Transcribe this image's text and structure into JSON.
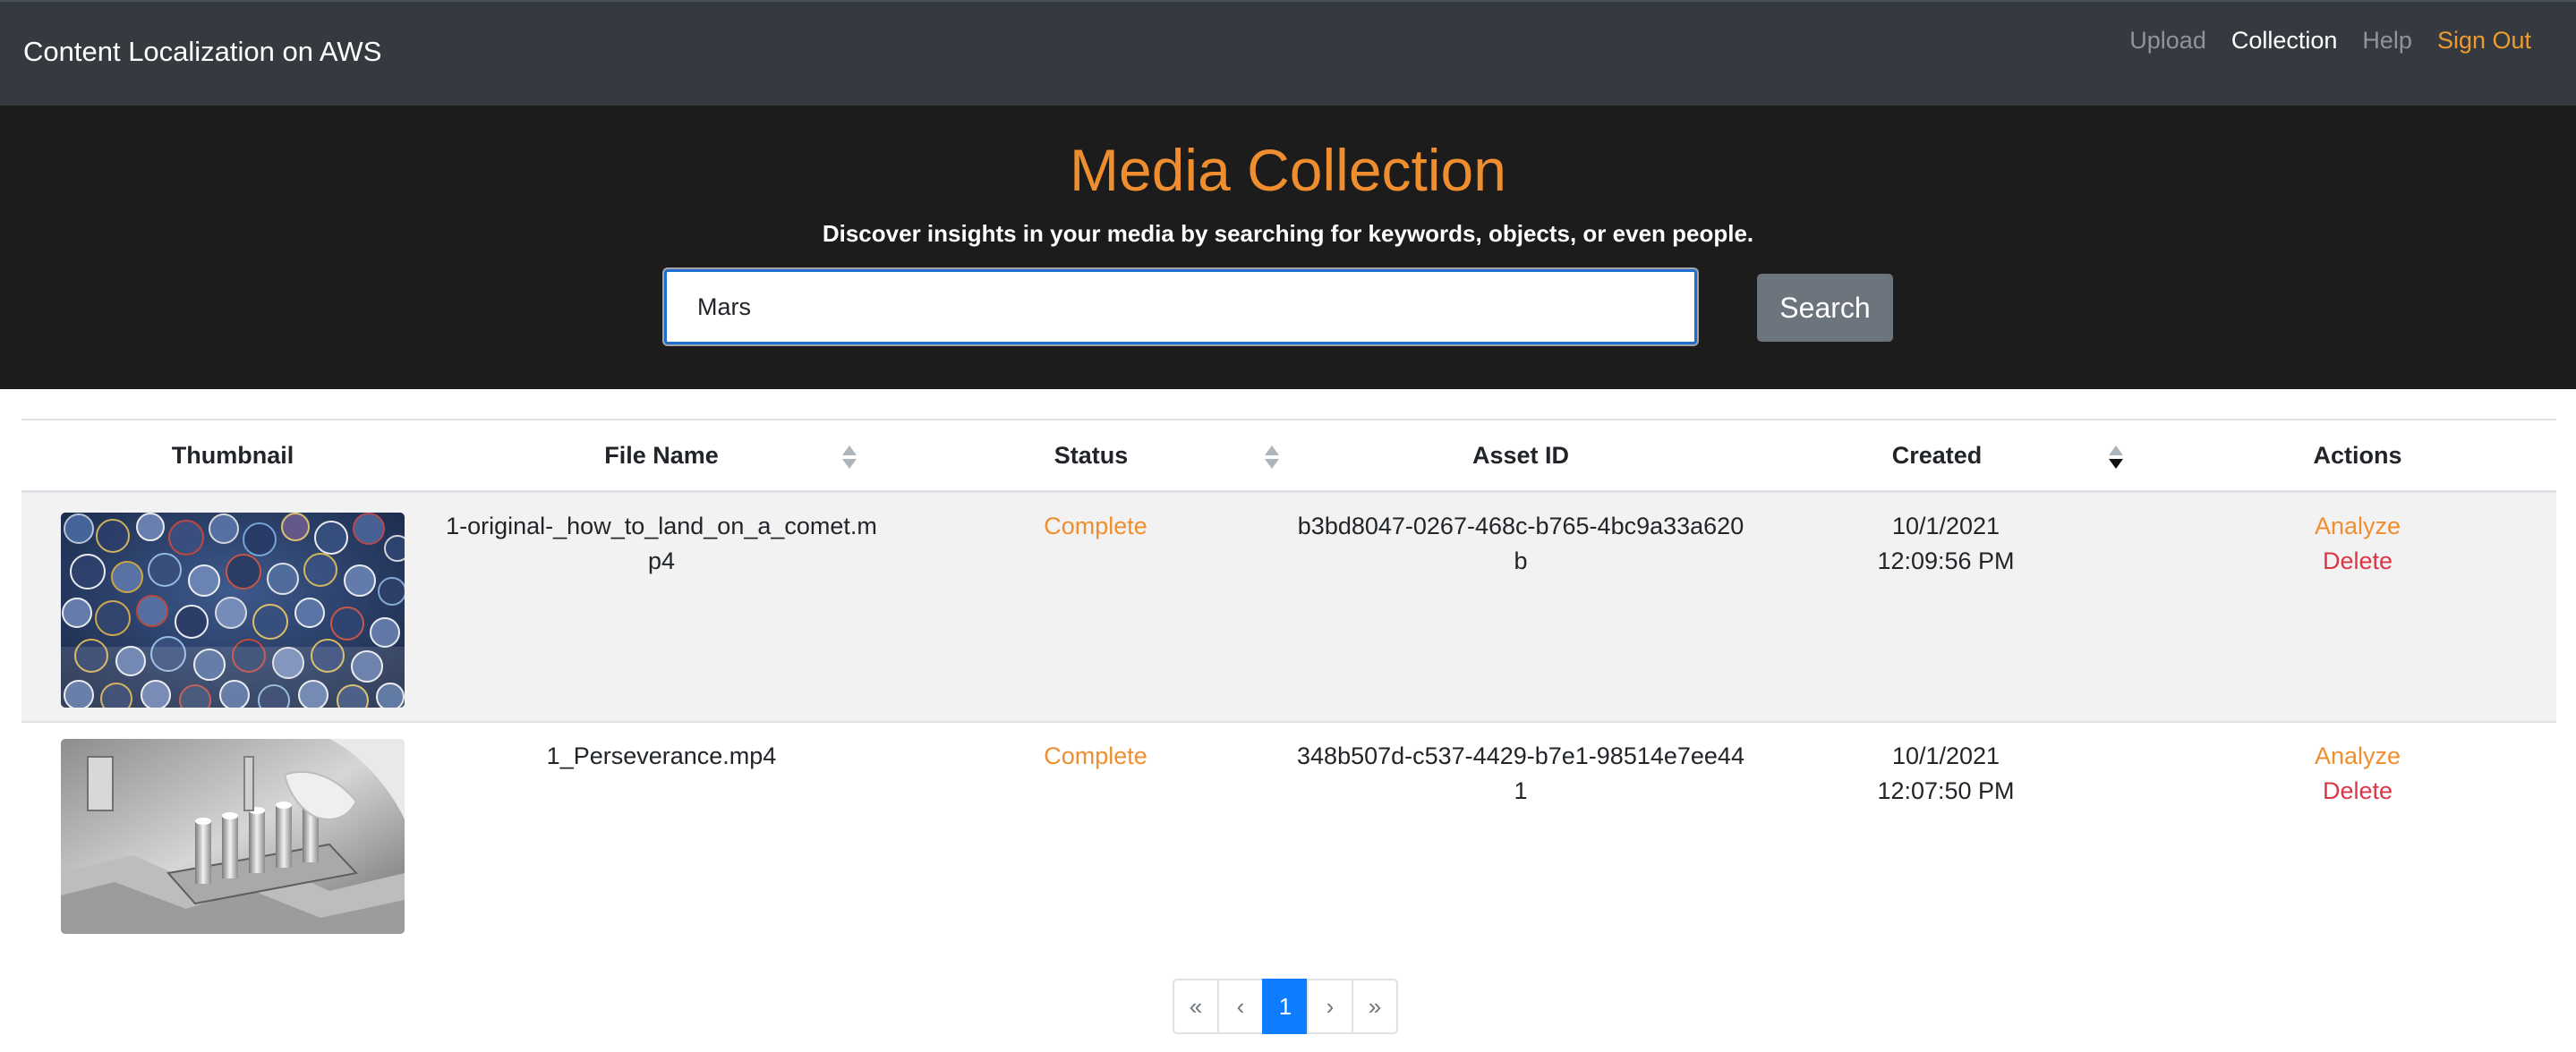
{
  "navbar": {
    "brand": "Content Localization on AWS",
    "links": {
      "upload": "Upload",
      "collection": "Collection",
      "help": "Help",
      "signout": "Sign Out"
    }
  },
  "hero": {
    "title": "Media Collection",
    "subtitle": "Discover insights in your media by searching for keywords, objects, or even people.",
    "search_value": "Mars",
    "search_button": "Search"
  },
  "table": {
    "headers": {
      "thumbnail": "Thumbnail",
      "file_name": "File Name",
      "status": "Status",
      "asset_id": "Asset ID",
      "created": "Created",
      "actions": "Actions"
    },
    "sort": {
      "active_column": "Created",
      "direction": "descending"
    },
    "rows": [
      {
        "file_name": "1-original-_how_to_land_on_a_comet.mp4",
        "status": "Complete",
        "asset_id": "b3bd8047-0267-468c-b765-4bc9a33a620b",
        "created_date": "10/1/2021",
        "created_time": "12:09:56 PM",
        "thumbnail": "mission-patches-collage",
        "analyze": "Analyze",
        "delete": "Delete"
      },
      {
        "file_name": "1_Perseverance.mp4",
        "status": "Complete",
        "asset_id": "348b507d-c537-4429-b7e1-98514e7ee441",
        "created_date": "10/1/2021",
        "created_time": "12:07:50 PM",
        "thumbnail": "sample-tubes-in-lab",
        "analyze": "Analyze",
        "delete": "Delete"
      }
    ]
  },
  "pagination": {
    "first": "«",
    "prev": "‹",
    "current": "1",
    "next": "›",
    "last": "»"
  },
  "colors": {
    "navbar_bg": "#343a40",
    "hero_bg": "#1c1c1c",
    "accent_orange": "#ef8e2e",
    "delete_red": "#dc3545",
    "page_active": "#0d7cff"
  }
}
